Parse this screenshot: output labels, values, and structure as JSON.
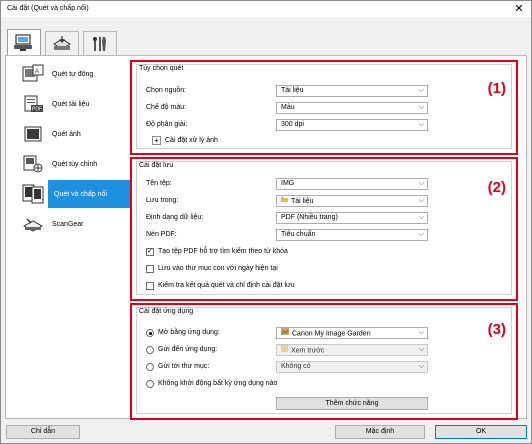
{
  "window": {
    "title": "Cài đặt (Quét và chấp nối)",
    "close_glyph": "✕"
  },
  "tabs": [
    {
      "icon": "scanner-computer-icon",
      "active": true
    },
    {
      "icon": "scanner-settings-icon",
      "active": false
    },
    {
      "icon": "tools-icon",
      "active": false
    }
  ],
  "sidebar": {
    "items": [
      {
        "label": "Quét tự động",
        "icon": "auto-scan-icon",
        "selected": false
      },
      {
        "label": "Quét tài liệu",
        "icon": "document-scan-icon",
        "selected": false
      },
      {
        "label": "Quét ảnh",
        "icon": "photo-scan-icon",
        "selected": false
      },
      {
        "label": "Quét tùy chỉnh",
        "icon": "custom-scan-icon",
        "selected": false
      },
      {
        "label": "Quét và chấp nối",
        "icon": "stitch-scan-icon",
        "selected": true
      },
      {
        "label": "ScanGear",
        "icon": "scangear-icon",
        "selected": false
      }
    ]
  },
  "scan_options": {
    "title": "Tùy chọn quét",
    "number": "(1)",
    "source_label": "Chọn nguồn:",
    "source_value": "Tài liệu",
    "color_label": "Chế độ màu:",
    "color_value": "Màu",
    "resolution_label": "Độ phân giải:",
    "resolution_value": "300 dpi",
    "image_processing_label": "Cài đặt xử lý ảnh",
    "expand_glyph": "+"
  },
  "save_settings": {
    "title": "Cài đặt lưu",
    "number": "(2)",
    "filename_label": "Tên tệp:",
    "filename_value": "IMG",
    "save_in_label": "Lưu trong:",
    "save_in_value": "Tài liệu",
    "format_label": "Định dạng dữ liệu:",
    "format_value": "PDF (Nhiều trang)",
    "compression_label": "Nén PDF:",
    "compression_value": "Tiêu chuẩn",
    "checkbox_searchable": {
      "label": "Tạo tệp PDF hỗ trợ tìm kiếm theo từ khóa",
      "checked": true
    },
    "checkbox_subfolder": {
      "label": "Lưu vào thư mục con với ngày hiện tại",
      "checked": false
    },
    "checkbox_check_results": {
      "label": "Kiểm tra kết quả quét và chỉ định cài đặt lưu",
      "checked": false
    }
  },
  "app_settings": {
    "title": "Cài đặt ứng dụng",
    "number": "(3)",
    "open_with_label": "Mở bằng ứng dụng:",
    "open_with_value": "Canon My Image Garden",
    "send_to_app_label": "Gửi đến ứng dụng:",
    "send_to_app_value": "Xem trước",
    "send_to_folder_label": "Gửi tới thư mục:",
    "send_to_folder_value": "Không có",
    "no_app_label": "Không khởi động bất kỳ ứng dụng nào",
    "add_button": "Thêm chức năng",
    "selected_option": "open_with"
  },
  "footer": {
    "help": "Chỉ dẫn",
    "defaults": "Mặc định",
    "ok": "OK"
  },
  "colors": {
    "accent": "#1e90e0",
    "highlight_border": "#e0001a"
  },
  "dropdown_arrow": "⌵",
  "check_glyph": "✓"
}
